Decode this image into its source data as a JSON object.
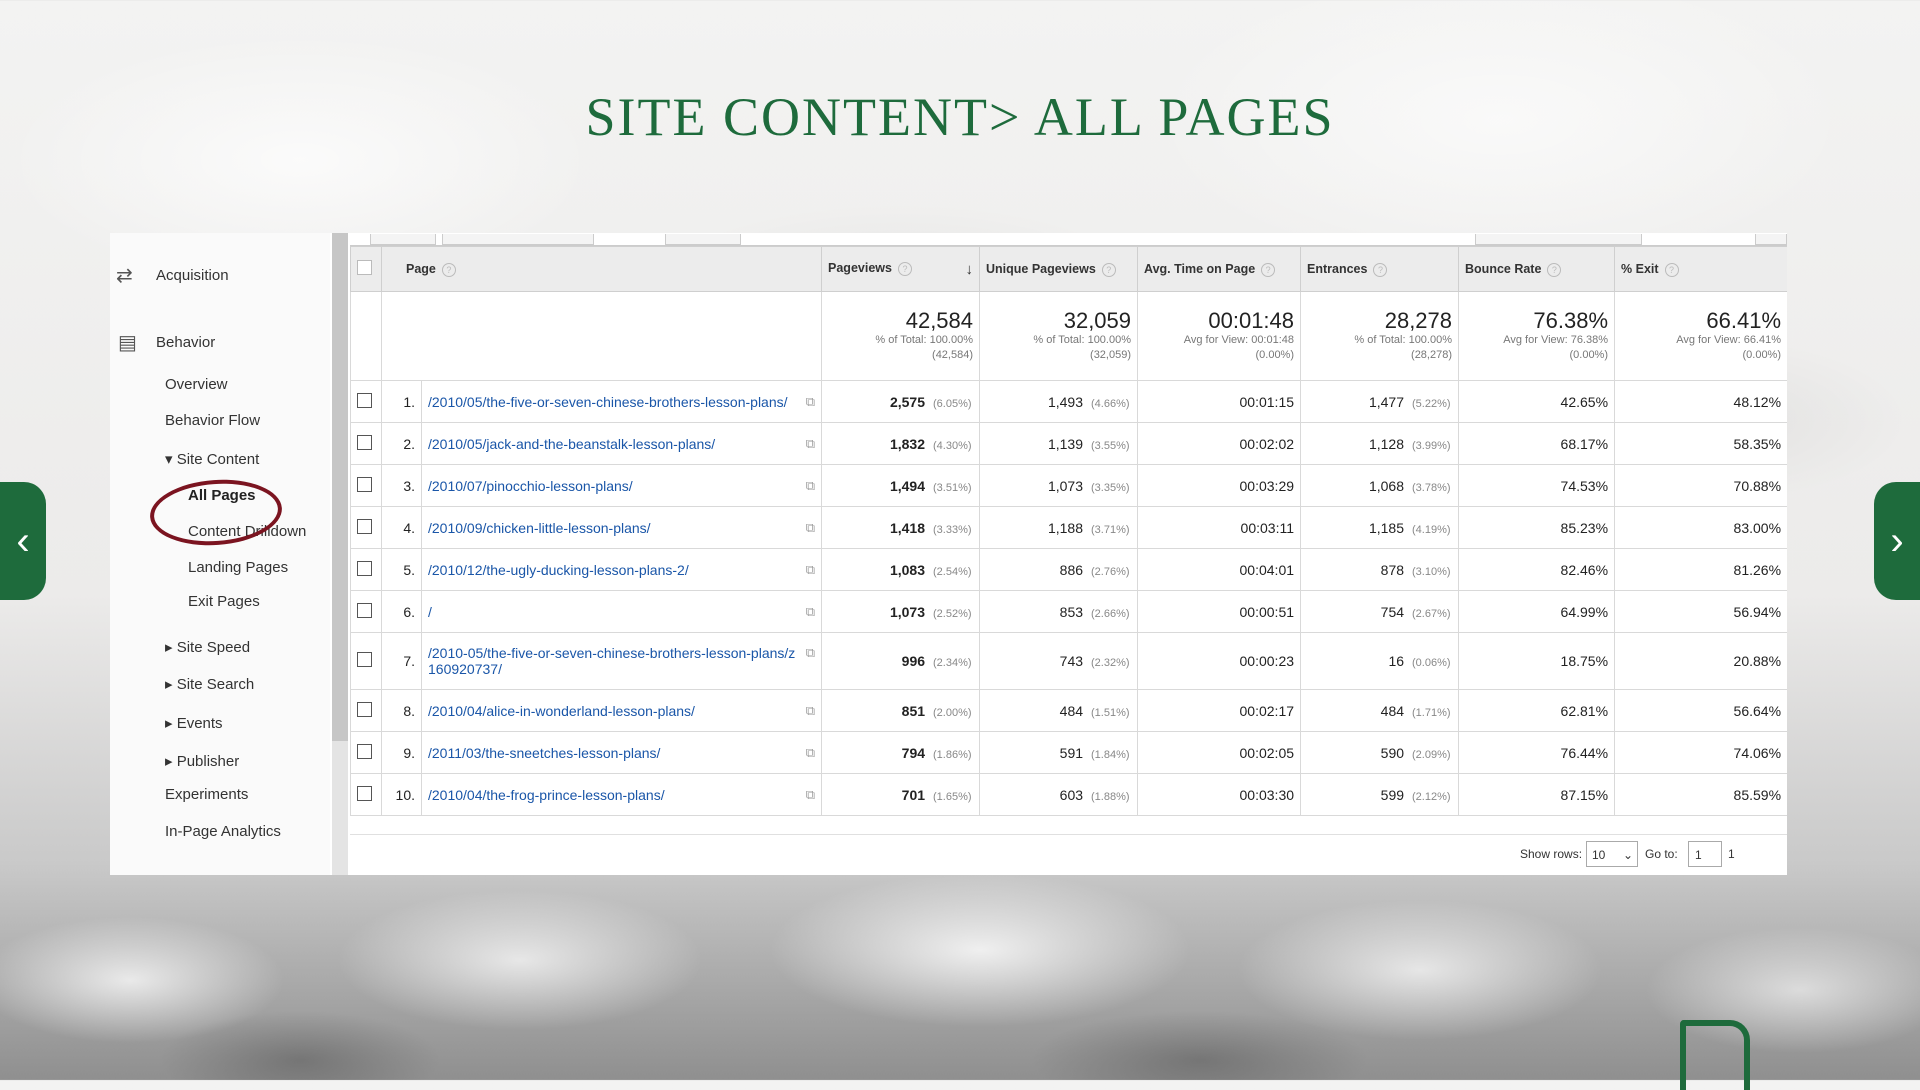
{
  "slide_title": "SITE CONTENT> ALL PAGES",
  "nav_arrows": {
    "prev": "‹",
    "next": "›"
  },
  "sidebar": {
    "acquisition": "Acquisition",
    "behavior": "Behavior",
    "overview": "Overview",
    "behavior_flow": "Behavior Flow",
    "site_content": "Site Content",
    "all_pages": "All Pages",
    "content_drilldown": "Content Drilldown",
    "landing_pages": "Landing Pages",
    "exit_pages": "Exit Pages",
    "site_speed": "Site Speed",
    "site_search": "Site Search",
    "events": "Events",
    "publisher": "Publisher",
    "experiments": "Experiments",
    "in_page_analytics": "In-Page Analytics"
  },
  "table": {
    "headers": [
      "Page",
      "Pageviews",
      "Unique Pageviews",
      "Avg. Time on Page",
      "Entrances",
      "Bounce Rate",
      "% Exit"
    ],
    "totals": {
      "pageviews": {
        "value": "42,584",
        "sub1": "% of Total: 100.00%",
        "sub2": "(42,584)"
      },
      "unique": {
        "value": "32,059",
        "sub1": "% of Total: 100.00%",
        "sub2": "(32,059)"
      },
      "avg_time": {
        "value": "00:01:48",
        "sub1": "Avg for View: 00:01:48",
        "sub2": "(0.00%)"
      },
      "entrances": {
        "value": "28,278",
        "sub1": "% of Total: 100.00%",
        "sub2": "(28,278)"
      },
      "bounce": {
        "value": "76.38%",
        "sub1": "Avg for View: 76.38%",
        "sub2": "(0.00%)"
      },
      "exit": {
        "value": "66.41%",
        "sub1": "Avg for View: 66.41%",
        "sub2": "(0.00%)"
      }
    },
    "rows": [
      {
        "idx": "1.",
        "page": "/2010/05/the-five-or-seven-chinese-brothers-lesson-plans/",
        "pv": "2,575",
        "pv_pct": "(6.05%)",
        "upv": "1,493",
        "upv_pct": "(4.66%)",
        "time": "00:01:15",
        "ent": "1,477",
        "ent_pct": "(5.22%)",
        "bounce": "42.65%",
        "exit": "48.12%"
      },
      {
        "idx": "2.",
        "page": "/2010/05/jack-and-the-beanstalk-lesson-plans/",
        "pv": "1,832",
        "pv_pct": "(4.30%)",
        "upv": "1,139",
        "upv_pct": "(3.55%)",
        "time": "00:02:02",
        "ent": "1,128",
        "ent_pct": "(3.99%)",
        "bounce": "68.17%",
        "exit": "58.35%"
      },
      {
        "idx": "3.",
        "page": "/2010/07/pinocchio-lesson-plans/",
        "pv": "1,494",
        "pv_pct": "(3.51%)",
        "upv": "1,073",
        "upv_pct": "(3.35%)",
        "time": "00:03:29",
        "ent": "1,068",
        "ent_pct": "(3.78%)",
        "bounce": "74.53%",
        "exit": "70.88%"
      },
      {
        "idx": "4.",
        "page": "/2010/09/chicken-little-lesson-plans/",
        "pv": "1,418",
        "pv_pct": "(3.33%)",
        "upv": "1,188",
        "upv_pct": "(3.71%)",
        "time": "00:03:11",
        "ent": "1,185",
        "ent_pct": "(4.19%)",
        "bounce": "85.23%",
        "exit": "83.00%"
      },
      {
        "idx": "5.",
        "page": "/2010/12/the-ugly-ducking-lesson-plans-2/",
        "pv": "1,083",
        "pv_pct": "(2.54%)",
        "upv": "886",
        "upv_pct": "(2.76%)",
        "time": "00:04:01",
        "ent": "878",
        "ent_pct": "(3.10%)",
        "bounce": "82.46%",
        "exit": "81.26%"
      },
      {
        "idx": "6.",
        "page": "/",
        "pv": "1,073",
        "pv_pct": "(2.52%)",
        "upv": "853",
        "upv_pct": "(2.66%)",
        "time": "00:00:51",
        "ent": "754",
        "ent_pct": "(2.67%)",
        "bounce": "64.99%",
        "exit": "56.94%"
      },
      {
        "idx": "7.",
        "page": "/2010-05/the-five-or-seven-chinese-brothers-lesson-plans/z",
        "page2": "160920737/",
        "pv": "996",
        "pv_pct": "(2.34%)",
        "upv": "743",
        "upv_pct": "(2.32%)",
        "time": "00:00:23",
        "ent": "16",
        "ent_pct": "(0.06%)",
        "bounce": "18.75%",
        "exit": "20.88%"
      },
      {
        "idx": "8.",
        "page": "/2010/04/alice-in-wonderland-lesson-plans/",
        "pv": "851",
        "pv_pct": "(2.00%)",
        "upv": "484",
        "upv_pct": "(1.51%)",
        "time": "00:02:17",
        "ent": "484",
        "ent_pct": "(1.71%)",
        "bounce": "62.81%",
        "exit": "56.64%"
      },
      {
        "idx": "9.",
        "page": "/2011/03/the-sneetches-lesson-plans/",
        "pv": "794",
        "pv_pct": "(1.86%)",
        "upv": "591",
        "upv_pct": "(1.84%)",
        "time": "00:02:05",
        "ent": "590",
        "ent_pct": "(2.09%)",
        "bounce": "76.44%",
        "exit": "74.06%"
      },
      {
        "idx": "10.",
        "page": "/2010/04/the-frog-prince-lesson-plans/",
        "pv": "701",
        "pv_pct": "(1.65%)",
        "upv": "603",
        "upv_pct": "(1.88%)",
        "time": "00:03:30",
        "ent": "599",
        "ent_pct": "(2.12%)",
        "bounce": "87.15%",
        "exit": "85.59%"
      }
    ]
  },
  "pager": {
    "show_rows_label": "Show rows:",
    "show_rows_value": "10",
    "goto_label": "Go to:",
    "goto_value": "1",
    "trailing": "1"
  },
  "colors": {
    "title_green": "#1e6b3c",
    "link_blue": "#1a56a8",
    "circle_red": "#7b1420"
  }
}
